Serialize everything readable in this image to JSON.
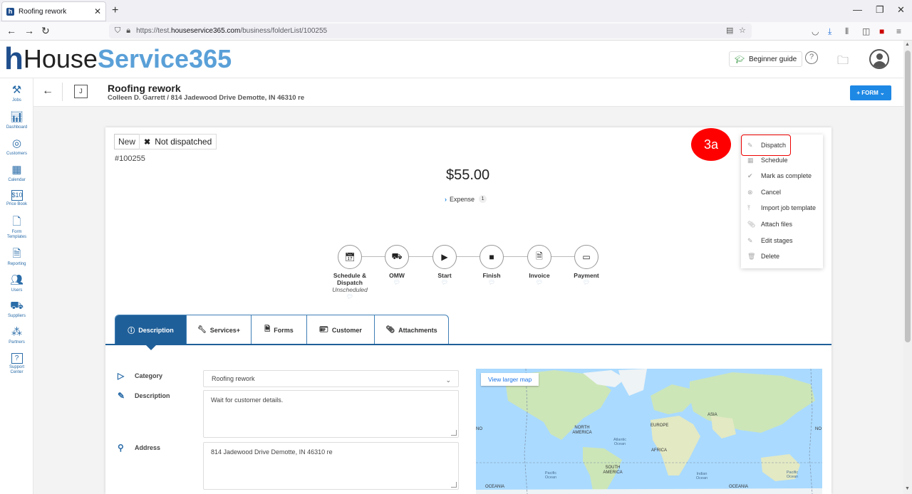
{
  "browser": {
    "tab_title": "Roofing rework",
    "url_prefix": "https://test.",
    "url_host": "houseservice365.com",
    "url_path": "/business/folderList/100255"
  },
  "header": {
    "logo_house": "House",
    "logo_service": "Service365",
    "beginner_guide": "Beginner guide"
  },
  "sidebar": {
    "items": [
      {
        "label": "Jobs",
        "icon": "tools-icon"
      },
      {
        "label": "Dashboard",
        "icon": "chart-icon"
      },
      {
        "label": "Customers",
        "icon": "target-icon"
      },
      {
        "label": "Calendar",
        "icon": "calendar-icon"
      },
      {
        "label": "Price Book",
        "icon": "price-icon"
      },
      {
        "label": "Form Templates",
        "icon": "form-icon"
      },
      {
        "label": "Reporting",
        "icon": "report-icon"
      },
      {
        "label": "Users",
        "icon": "users-icon"
      },
      {
        "label": "Suppliers",
        "icon": "truck-icon"
      },
      {
        "label": "Partners",
        "icon": "partners-icon"
      },
      {
        "label": "Support Center",
        "icon": "help-icon"
      }
    ]
  },
  "job": {
    "badge": "J",
    "title": "Roofing rework",
    "subtitle": "Colleen D. Garrett / 814 Jadewood Drive Demotte, IN 46310 re",
    "form_button": "+ FORM ⌄",
    "status_new": "New",
    "status_dispatch": "Not dispatched",
    "number": "#100255",
    "price": "$55.00",
    "expense_label": "Expense",
    "expense_count": "1"
  },
  "stages": [
    {
      "label": "Schedule & Dispatch",
      "sub": "Unscheduled",
      "icon": "calendar-check-icon"
    },
    {
      "label": "OMW",
      "sub": "",
      "icon": "truck-icon"
    },
    {
      "label": "Start",
      "sub": "",
      "icon": "play-icon"
    },
    {
      "label": "Finish",
      "sub": "",
      "icon": "stop-icon"
    },
    {
      "label": "Invoice",
      "sub": "",
      "icon": "document-icon"
    },
    {
      "label": "Payment",
      "sub": "",
      "icon": "card-icon"
    }
  ],
  "tabs": [
    {
      "label": "Description",
      "icon": "info-icon"
    },
    {
      "label": "Services+",
      "icon": "wrench-icon"
    },
    {
      "label": "Forms",
      "icon": "form-icon"
    },
    {
      "label": "Customer",
      "icon": "id-card-icon"
    },
    {
      "label": "Attachments",
      "icon": "paperclip-icon"
    }
  ],
  "fields": {
    "category_label": "Category",
    "category_value": "Roofing rework",
    "description_label": "Description",
    "description_value": "Wait for customer details.",
    "address_label": "Address",
    "address_value": "814 Jadewood Drive Demotte, IN 46310 re"
  },
  "map": {
    "button": "View larger map",
    "labels": {
      "north_america": "NORTH AMERICA",
      "europe": "EUROPE",
      "asia": "ASIA",
      "africa": "AFRICA",
      "south_america": "SOUTH AMERICA",
      "atlantic": "Atlantic Ocean",
      "indian": "Indian Ocean",
      "pacific_1": "Pacific Ocean",
      "pacific_2": "Pacific Ocean",
      "oceania_1": "OCEANIA",
      "oceania_2": "OCEANIA",
      "no_1": "NO",
      "no_2": "NO"
    }
  },
  "menu": {
    "items": [
      {
        "label": "Dispatch",
        "icon": "pencil-icon"
      },
      {
        "label": "Schedule",
        "icon": "calendar-icon"
      },
      {
        "label": "Mark as complete",
        "icon": "check-icon"
      },
      {
        "label": "Cancel",
        "icon": "cancel-icon"
      },
      {
        "label": "Import job template",
        "icon": "upload-icon"
      },
      {
        "label": "Attach files",
        "icon": "paperclip-icon"
      },
      {
        "label": "Edit stages",
        "icon": "pencil-icon"
      },
      {
        "label": "Delete",
        "icon": "trash-icon"
      }
    ]
  },
  "annotation": {
    "step": "3a"
  },
  "colors": {
    "brand_blue": "#1f5f99",
    "accent_blue": "#1e88e5",
    "annotation_red": "#ff0000"
  }
}
